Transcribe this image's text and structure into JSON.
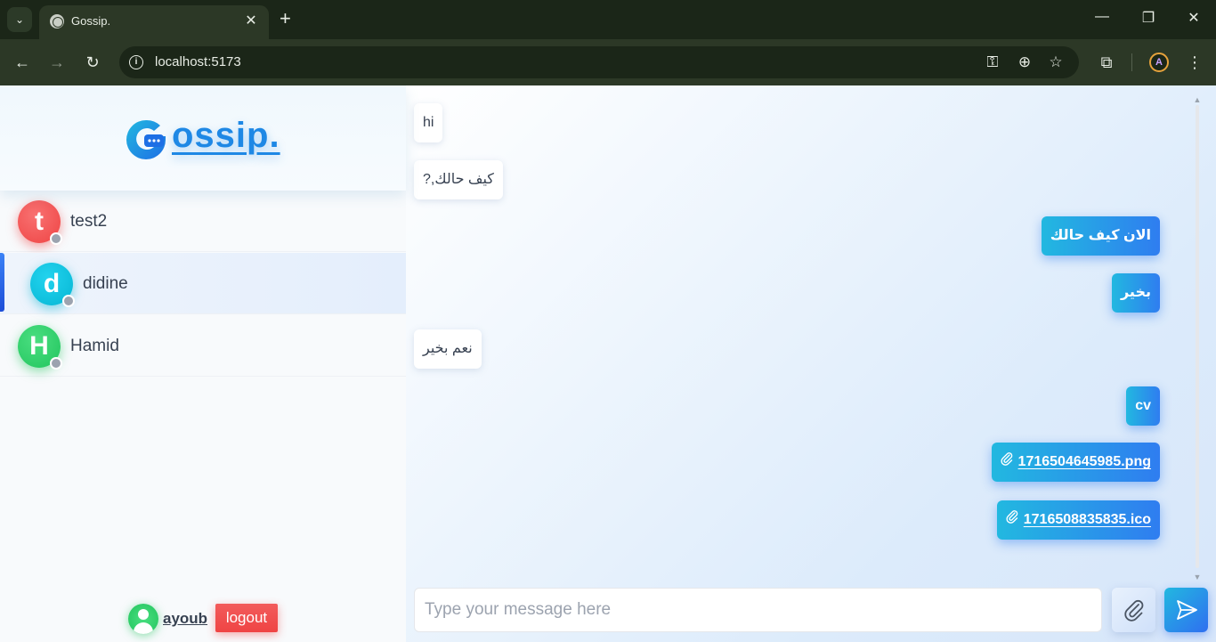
{
  "browser": {
    "tab_title": "Gossip.",
    "url": "localhost:5173",
    "controls": {
      "tab_menu": "⌄",
      "close_tab": "✕",
      "new_tab": "+",
      "minimize": "—",
      "restore": "❐",
      "close_window": "✕",
      "back": "←",
      "forward": "→",
      "reload": "↻",
      "site_info": "i",
      "password": "⚿",
      "zoom": "⊕",
      "bookmark": "☆",
      "extensions": "⧉",
      "profile": "A",
      "menu": "⋮"
    }
  },
  "app": {
    "logo_letter": "G",
    "logo_text": "ossip.",
    "contacts": [
      {
        "initial": "t",
        "name": "test2",
        "color": "#ef4444",
        "online": false,
        "active": false
      },
      {
        "initial": "d",
        "name": "didine",
        "color": "#06b6d4",
        "online": false,
        "active": true
      },
      {
        "initial": "H",
        "name": "Hamid",
        "color": "#22c55e",
        "online": false,
        "active": false
      }
    ],
    "current_user": {
      "name": "ayoub"
    },
    "logout_label": "logout"
  },
  "chat": {
    "messages": [
      {
        "direction": "in",
        "text": "hi"
      },
      {
        "direction": "in",
        "text": "?,كيف حالك"
      },
      {
        "direction": "out",
        "text": "الان كيف حالك"
      },
      {
        "direction": "out",
        "text": "بخير"
      },
      {
        "direction": "in",
        "text": "نعم بخير"
      },
      {
        "direction": "out",
        "text": "cv"
      },
      {
        "direction": "out",
        "type": "file",
        "text": "1716504645985.png"
      },
      {
        "direction": "out",
        "type": "file",
        "text": "1716508835835.ico"
      }
    ],
    "composer_placeholder": "Type your message here",
    "composer_value": ""
  },
  "colors": {
    "accent": "#2f7df0",
    "accent_light": "#22b8e0",
    "logout": "#ef4444",
    "logo": "#1e88e5"
  },
  "icons": {
    "attach": "paperclip-icon",
    "send": "send-icon"
  }
}
